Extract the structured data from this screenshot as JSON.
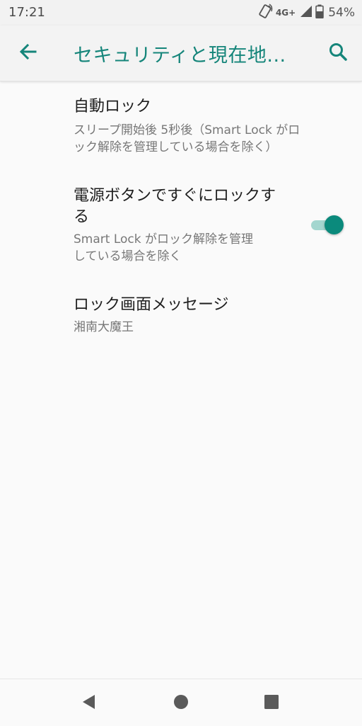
{
  "status_bar": {
    "time": "17:21",
    "network": "4G+",
    "battery_percent": "54%",
    "icons": [
      "vibrate-icon",
      "signal-icon",
      "battery-icon"
    ]
  },
  "app_bar": {
    "title": "セキュリティと現在地...",
    "back_icon": "arrow-left-icon",
    "search_icon": "search-icon",
    "accent_color": "#15857a"
  },
  "preferences": [
    {
      "title": "自動ロック",
      "summary_lines": [
        "スリープ開始後 5秒後（Smart Lock がロ",
        "ック解除を管理している場合を除く）"
      ]
    },
    {
      "title_lines": [
        "電源ボタンですぐにロックす",
        "る"
      ],
      "summary_lines": [
        "Smart Lock がロック解除を管理",
        "している場合を除く"
      ],
      "toggle_on": true
    },
    {
      "title": "ロック画面メッセージ",
      "summary": "湘南大魔王"
    }
  ],
  "nav_bar": {
    "back_icon": "nav-back-icon",
    "home_icon": "nav-home-icon",
    "recents_icon": "nav-recents-icon"
  }
}
